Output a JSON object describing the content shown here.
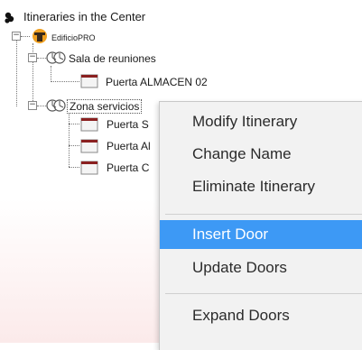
{
  "tree": {
    "root_label": "Itineraries in the Center",
    "building_label": "EdificioPRO",
    "groups": [
      {
        "label": "Sala de reuniones",
        "doors": [
          "Puerta ALMACEN 02"
        ]
      },
      {
        "label": "Zona servicios",
        "doors": [
          "Puerta S",
          "Puerta Al",
          "Puerta C"
        ]
      }
    ],
    "expander_open": "−"
  },
  "context_menu": {
    "items": [
      "Modify Itinerary",
      "Change Name",
      "Eliminate Itinerary",
      "Insert Door",
      "Update Doors",
      "Expand Doors"
    ],
    "highlighted": "Insert Door"
  },
  "colors": {
    "highlight": "#3d99f5",
    "menu_bg": "#f2f2f2",
    "building_icon": "#f0a020",
    "door_icon": "#8a2020"
  }
}
